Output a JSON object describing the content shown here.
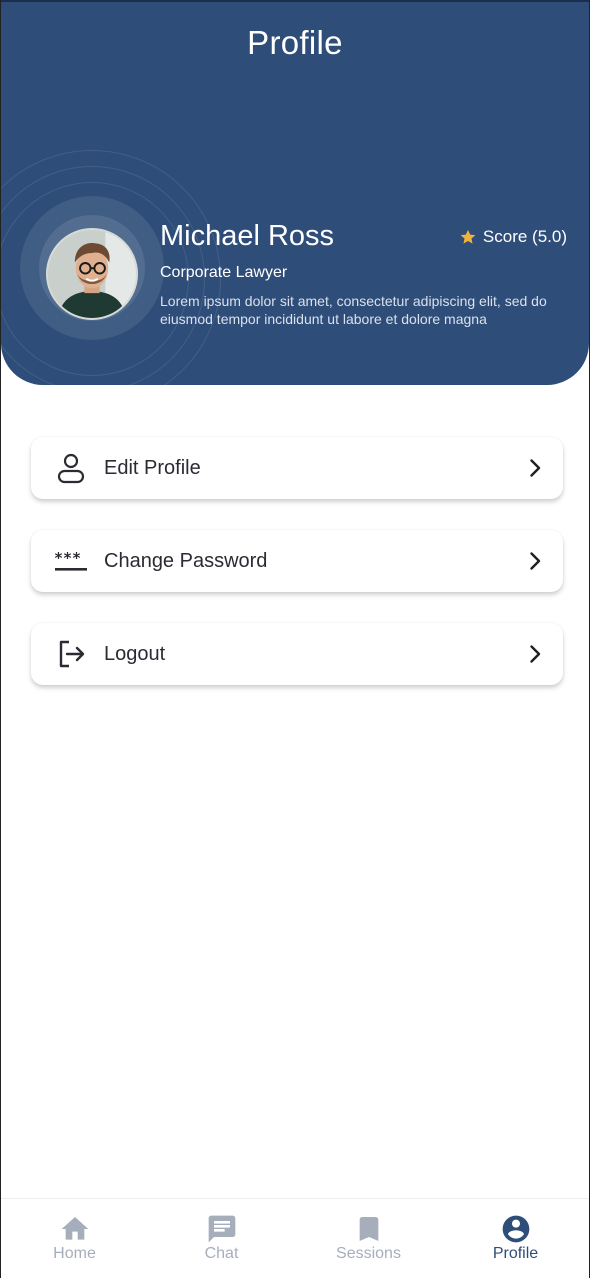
{
  "header": {
    "title": "Profile"
  },
  "profile": {
    "name": "Michael Ross",
    "role": "Corporate Lawyer",
    "bio": "Lorem ipsum dolor sit amet, consectetur adipiscing elit, sed do eiusmod tempor incididunt ut labore et dolore magna",
    "score_label": "Score (5.0)"
  },
  "menu": [
    {
      "label": "Edit Profile",
      "icon": "user-outline-icon"
    },
    {
      "label": "Change Password",
      "icon": "password-icon"
    },
    {
      "label": "Logout",
      "icon": "logout-icon"
    }
  ],
  "nav": [
    {
      "label": "Home",
      "icon": "home-icon",
      "active": false
    },
    {
      "label": "Chat",
      "icon": "chat-icon",
      "active": false
    },
    {
      "label": "Sessions",
      "icon": "bookmark-icon",
      "active": false
    },
    {
      "label": "Profile",
      "icon": "account-circle-icon",
      "active": true
    }
  ],
  "colors": {
    "primary": "#2e4d78",
    "star": "#f2b33d",
    "nav_inactive": "#a7aebb"
  }
}
